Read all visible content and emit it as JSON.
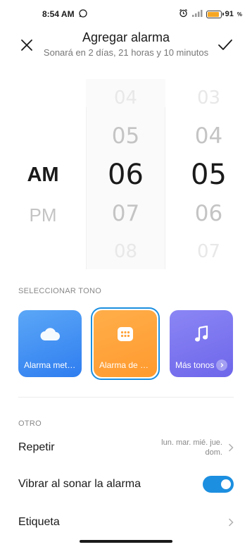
{
  "status_bar": {
    "time": "8:54 AM",
    "battery_percent": "91",
    "battery_level": 0.91,
    "icons": [
      "whatsapp-icon",
      "alarm-icon",
      "signal-icon",
      "battery-icon"
    ]
  },
  "header": {
    "title": "Agregar alarma",
    "subtitle": "Sonará en 2 días, 21 horas y 10 minutos",
    "close_icon": "close-icon",
    "confirm_icon": "check-icon"
  },
  "picker": {
    "ampm": {
      "selected": "AM",
      "next": "PM"
    },
    "hour": {
      "far_prev": "04",
      "prev": "05",
      "selected": "06",
      "next": "07",
      "far_next": "08"
    },
    "minute": {
      "far_prev": "03",
      "prev": "04",
      "selected": "05",
      "next": "06",
      "far_next": "07"
    }
  },
  "tone_section": {
    "label": "SELECCIONAR TONO",
    "cards": [
      {
        "label": "Alarma meteo…",
        "icon": "cloud-icon",
        "color": "#3b8af2"
      },
      {
        "label": "Alarma de nat…",
        "icon": "grid-icon",
        "color": "#ffa23a",
        "selected": true
      },
      {
        "label": "Más tonos",
        "icon": "music-note-icon",
        "color": "#7a73ef"
      }
    ]
  },
  "other_section": {
    "label": "OTRO",
    "repeat": {
      "label": "Repetir",
      "value": "lun. mar. mié. jue. dom."
    },
    "vibrate": {
      "label": "Vibrar al sonar la alarma",
      "enabled": true
    },
    "tag": {
      "label": "Etiqueta"
    }
  },
  "colors": {
    "accent": "#1c8fe0"
  }
}
